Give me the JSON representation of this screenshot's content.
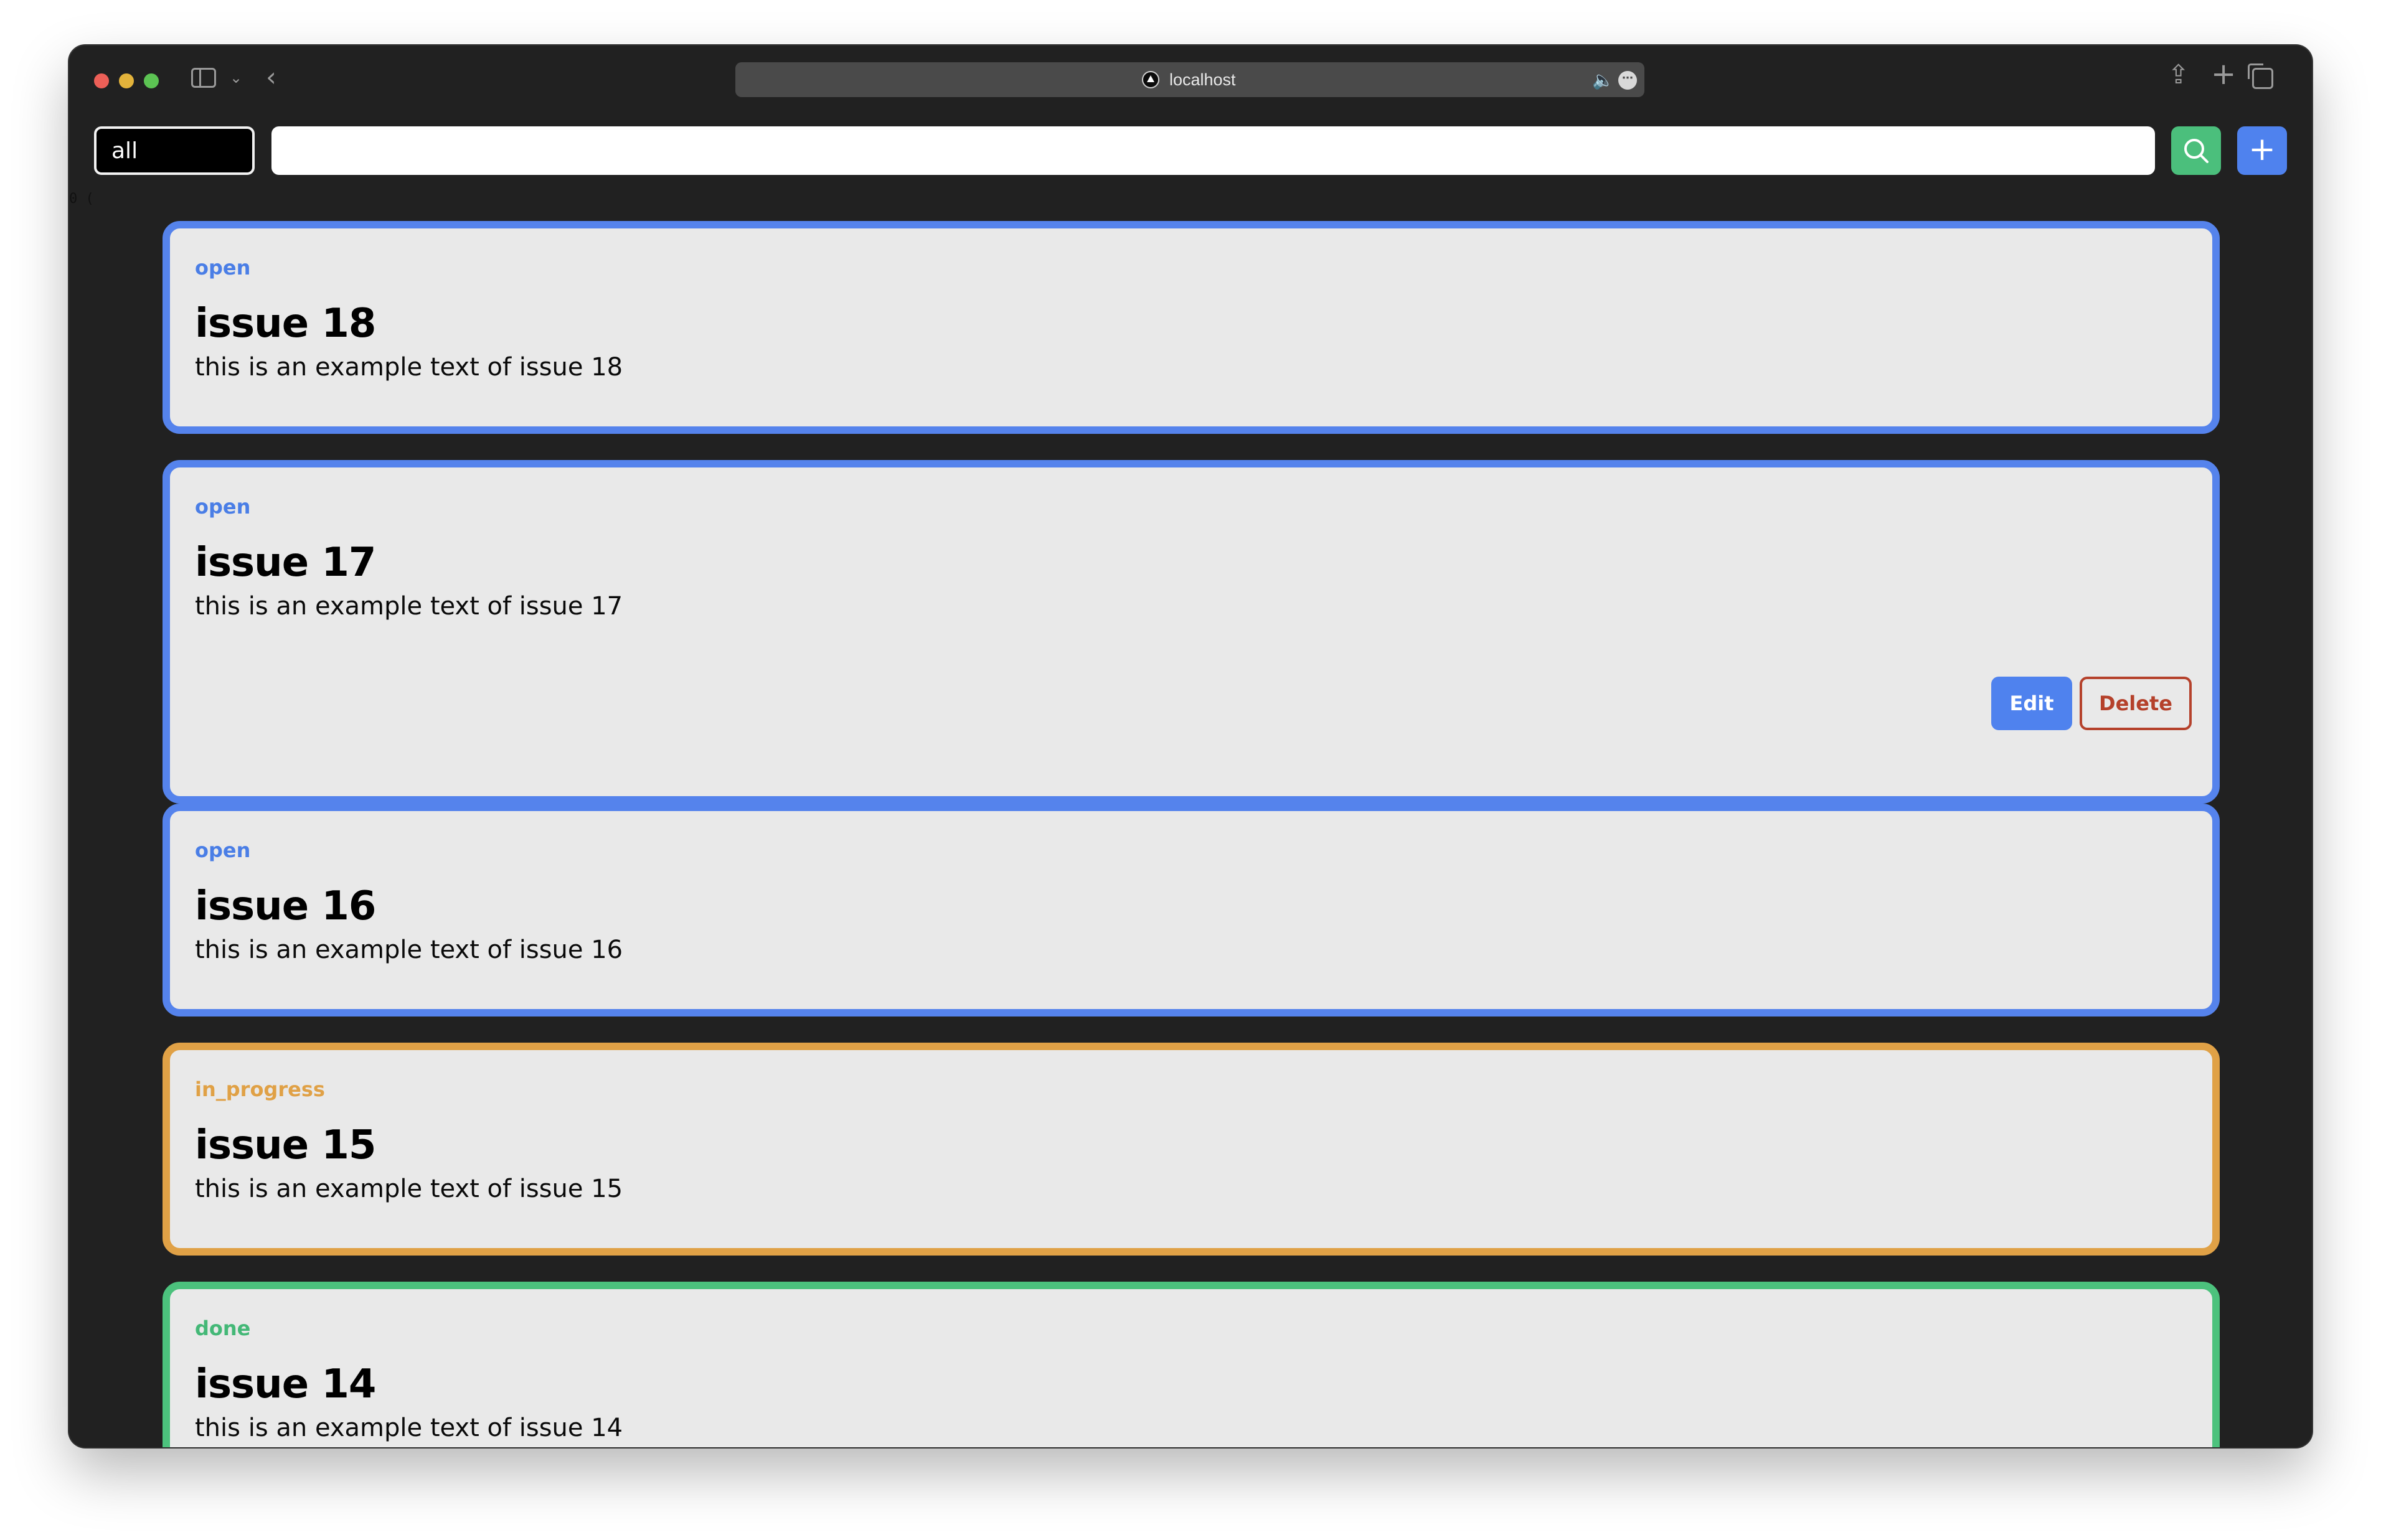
{
  "browser": {
    "url": "localhost"
  },
  "toolbar": {
    "filter_value": "all",
    "search_value": "",
    "add_label": "+"
  },
  "stray_text": "0 (",
  "issues": [
    {
      "status": "open",
      "title": "issue 18",
      "text": "this is an example text of issue 18"
    },
    {
      "status": "open",
      "title": "issue 17",
      "text": "this is an example text of issue 17",
      "edit_label": "Edit",
      "delete_label": "Delete"
    },
    {
      "status": "open",
      "title": "issue 16",
      "text": "this is an example text of issue 16"
    },
    {
      "status": "in_progress",
      "title": "issue 15",
      "text": "this is an example text of issue 15"
    },
    {
      "status": "done",
      "title": "issue 14",
      "text": "this is an example text of issue 14"
    }
  ],
  "colors": {
    "window_bg": "#212121",
    "open": "#5583ec",
    "in_progress": "#e0a146",
    "done": "#4cc27d",
    "delete": "#b5412b",
    "search_button": "#4bbf7c",
    "add_button": "#4f82ee"
  }
}
